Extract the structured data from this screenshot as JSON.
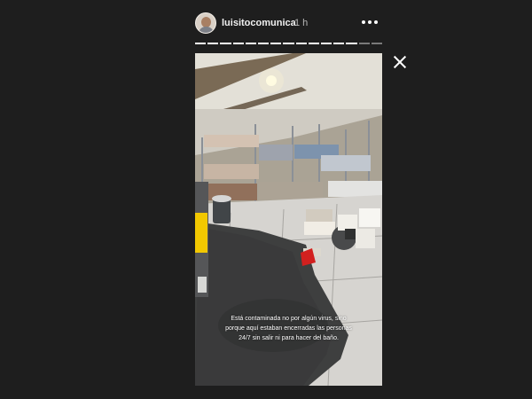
{
  "story": {
    "username": "luisitocomunica",
    "time": "1 h",
    "caption_lines": [
      "Está contaminada no por algún virus, sino",
      "porque aquí estaban encerradas las personas",
      "24/7 sin salir ni para hacer del baño."
    ],
    "segments_total": 15,
    "segments_viewed": 13,
    "icons": {
      "more": "more-options-icon",
      "close": "close-icon"
    },
    "colors": {
      "background": "#1e1e1e",
      "progress_viewed": "#ffffff",
      "progress_unviewed": "#7a7a7a",
      "text": "#ffffff"
    }
  }
}
